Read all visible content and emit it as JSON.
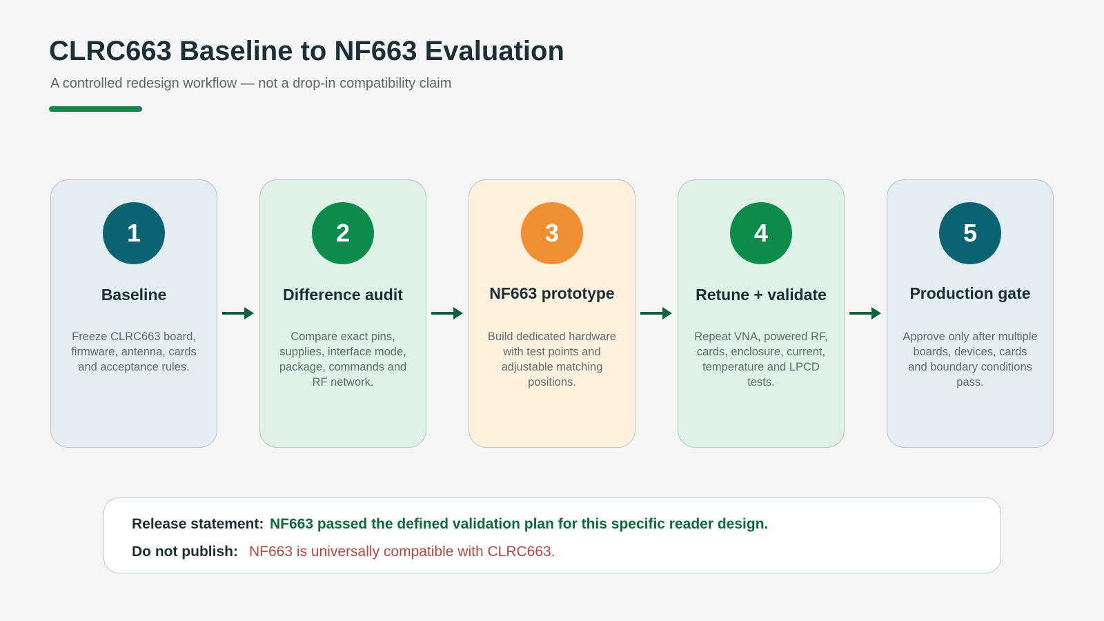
{
  "header": {
    "title": "CLRC663 Baseline to NF663 Evaluation",
    "subtitle": "A controlled redesign workflow — not a drop-in compatibility claim"
  },
  "steps": [
    {
      "number": "1",
      "title": "Baseline",
      "description": "Freeze CLRC663 board, firmware, antenna, cards and acceptance rules."
    },
    {
      "number": "2",
      "title": "Difference audit",
      "description": "Compare exact pins, supplies, interface mode, package, commands and RF network."
    },
    {
      "number": "3",
      "title": "NF663 prototype",
      "description": "Build dedicated hardware with test points and adjustable matching positions."
    },
    {
      "number": "4",
      "title": "Retune + validate",
      "description": "Repeat VNA, powered RF, cards, enclosure, current, temperature and LPCD tests."
    },
    {
      "number": "5",
      "title": "Production gate",
      "description": "Approve only after multiple boards, devices, cards and boundary conditions pass."
    }
  ],
  "callout": {
    "release_label": "Release statement:",
    "release_text": "NF663 passed the defined validation plan for this specific reader design.",
    "warning_label": "Do not publish:",
    "warning_text": "NF663 is universally compatible with CLRC663."
  },
  "colors": {
    "accent": "#13884a",
    "teal": "#0c6472",
    "green": "#0c8c4a",
    "orange": "#ef8e32",
    "arrow": "#11603f",
    "warning": "#b5463c"
  }
}
